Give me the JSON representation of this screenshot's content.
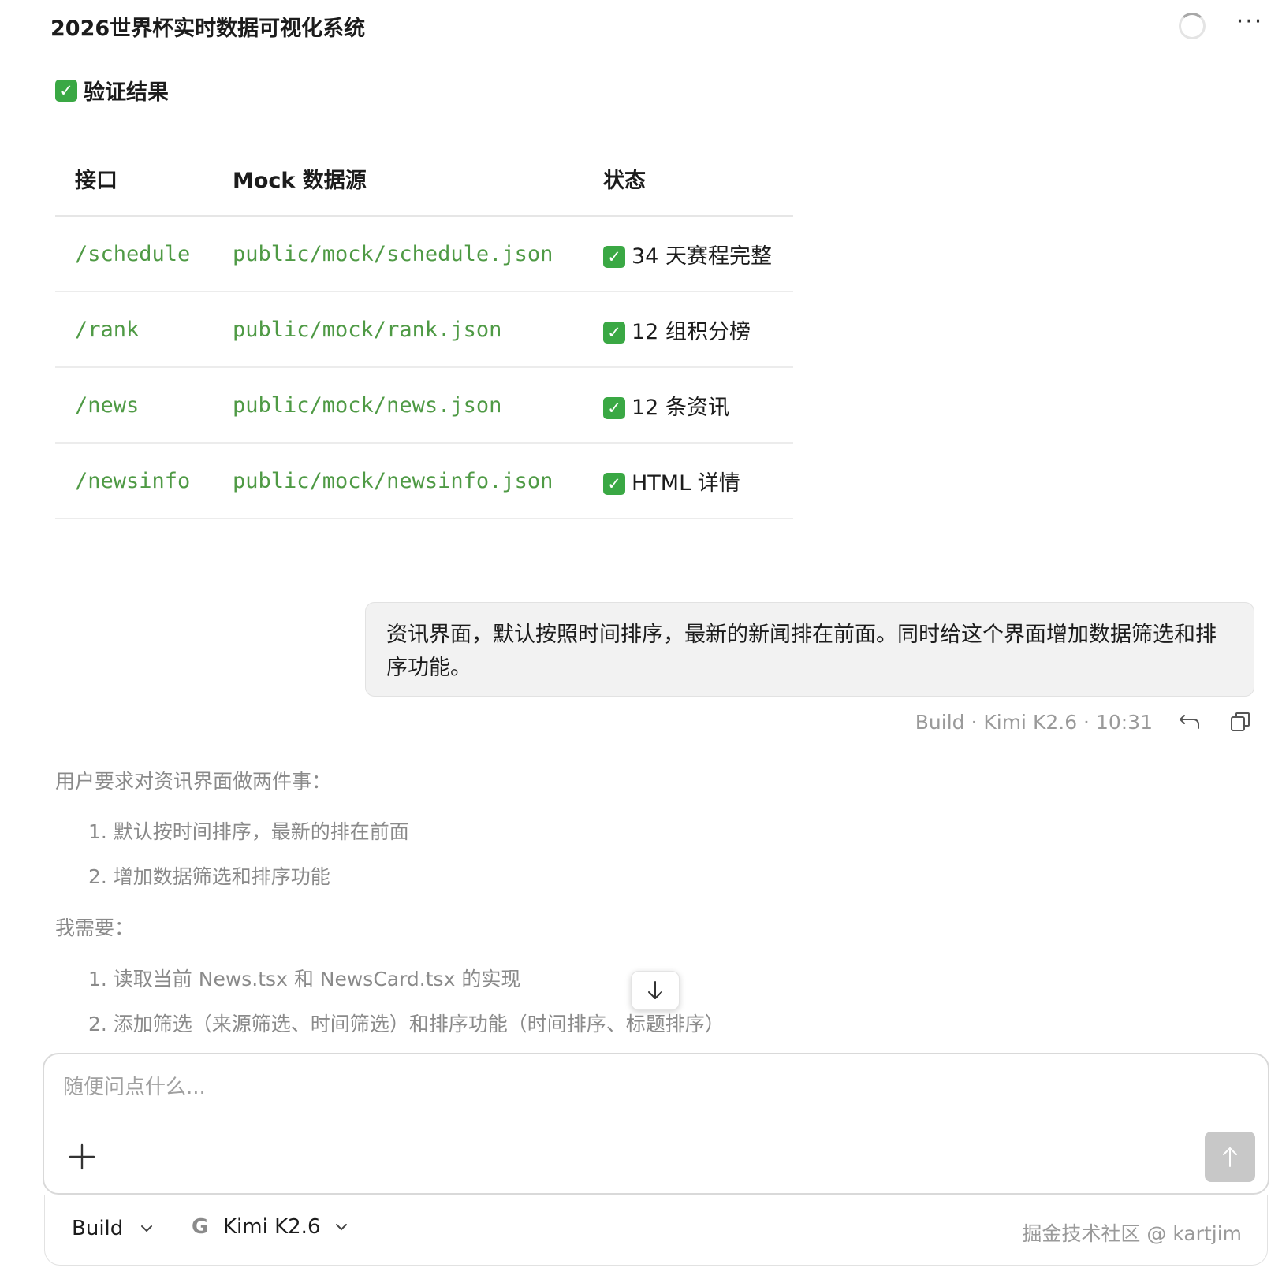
{
  "header": {
    "title": "2026世界杯实时数据可视化系统"
  },
  "verify": {
    "check": "✓",
    "title": "验证结果"
  },
  "table": {
    "headers": [
      "接口",
      "Mock 数据源",
      "状态"
    ],
    "rows": [
      {
        "endpoint": "/schedule",
        "source": "public/mock/schedule.json",
        "status": "34 天赛程完整"
      },
      {
        "endpoint": "/rank",
        "source": "public/mock/rank.json",
        "status": "12 组积分榜"
      },
      {
        "endpoint": "/news",
        "source": "public/mock/news.json",
        "status": "12 条资讯"
      },
      {
        "endpoint": "/newsinfo",
        "source": "public/mock/newsinfo.json",
        "status": "HTML 详情"
      }
    ]
  },
  "user_message": {
    "text": "资讯界面，默认按照时间排序，最新的新闻排在前面。同时给这个界面增加数据筛选和排序功能。",
    "meta": "Build · Kimi K2.6 · 10:31"
  },
  "assistant": {
    "intro": "用户要求对资讯界面做两件事：",
    "tasks": [
      "1. 默认按时间排序，最新的排在前面",
      "2. 增加数据筛选和排序功能"
    ],
    "need_label": "我需要：",
    "steps": [
      "1. 读取当前 News.tsx 和 NewsCard.tsx 的实现",
      "2. 添加筛选（来源筛选、时间筛选）和排序功能（时间排序、标题排序）"
    ]
  },
  "composer": {
    "placeholder": "随便问点什么..."
  },
  "bottom": {
    "mode": "Build",
    "model_logo": "G",
    "model": "Kimi K2.6",
    "watermark": "掘金技术社区 @ kartjim"
  },
  "colors": {
    "code": "#4f9a45",
    "check": "#3aa844",
    "send_disabled": "#c8c8c8"
  }
}
